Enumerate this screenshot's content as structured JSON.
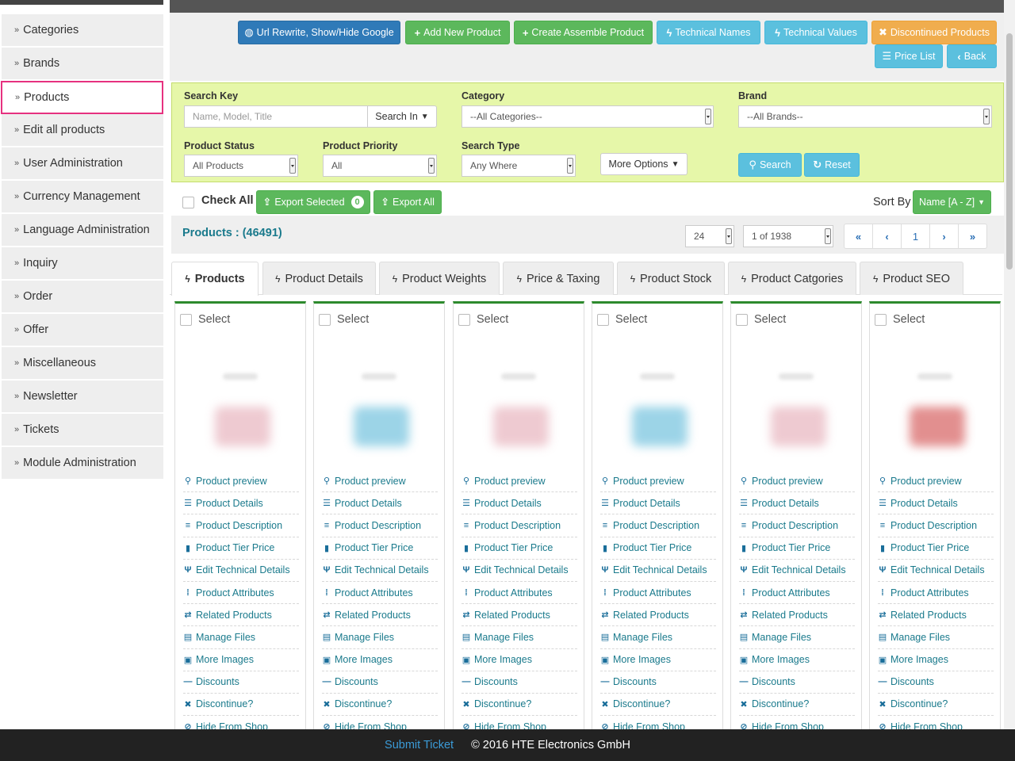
{
  "sidebar": {
    "items": [
      {
        "label": "Categories"
      },
      {
        "label": "Brands"
      },
      {
        "label": "Products"
      },
      {
        "label": "Edit all products"
      },
      {
        "label": "User Administration"
      },
      {
        "label": "Currency Management"
      },
      {
        "label": "Language Administration"
      },
      {
        "label": "Inquiry"
      },
      {
        "label": "Order"
      },
      {
        "label": "Offer"
      },
      {
        "label": "Miscellaneous"
      },
      {
        "label": "Newsletter"
      },
      {
        "label": "Tickets"
      },
      {
        "label": "Module Administration"
      }
    ],
    "active_item": "Products",
    "bullet": "»"
  },
  "toolbar": {
    "url_rewrite": "Url Rewrite, Show/Hide Google",
    "add_new_product": "Add New Product",
    "create_assemble_product": "Create Assemble Product",
    "technical_names": "Technical Names",
    "technical_values": "Technical Values",
    "discontinued_products": "Discontinued Products",
    "price_list": "Price List",
    "back": "Back"
  },
  "search": {
    "search_key_label": "Search Key",
    "search_key_placeholder": "Name, Model, Title",
    "search_in": "Search In",
    "category_label": "Category",
    "category_value": "--All Categories--",
    "brand_label": "Brand",
    "brand_value": "--All Brands--",
    "status_label": "Product Status",
    "status_value": "All Products",
    "priority_label": "Product Priority",
    "priority_value": "All",
    "type_label": "Search Type",
    "type_value": "Any Where",
    "more_options": "More Options",
    "search_button": "Search",
    "reset_button": "Reset"
  },
  "bulk": {
    "check_all": "Check All",
    "export_selected": "Export Selected",
    "selected_count": "0",
    "export_all": "Export All",
    "sort_by": "Sort By",
    "sort_value": "Name [A - Z]"
  },
  "results": {
    "count_label": "Products : (46491)",
    "per_page": "24",
    "page_of": "1 of 1938",
    "current_page": "1"
  },
  "tabs": [
    {
      "label": "Products"
    },
    {
      "label": "Product Details"
    },
    {
      "label": "Product Weights"
    },
    {
      "label": "Price & Taxing"
    },
    {
      "label": "Product Stock"
    },
    {
      "label": "Product Catgories"
    },
    {
      "label": "Product SEO"
    }
  ],
  "card": {
    "select": "Select",
    "actions": [
      {
        "label": "Product preview",
        "icon": "search-icon"
      },
      {
        "label": "Product Details",
        "icon": "list-icon"
      },
      {
        "label": "Product Description",
        "icon": "align-left-icon"
      },
      {
        "label": "Product Tier Price",
        "icon": "bar-chart-icon"
      },
      {
        "label": "Edit Technical Details",
        "icon": "cutlery-icon"
      },
      {
        "label": "Product Attributes",
        "icon": "grid-icon"
      },
      {
        "label": "Related Products",
        "icon": "retweet-icon"
      },
      {
        "label": "Manage Files",
        "icon": "file-icon"
      },
      {
        "label": "More Images",
        "icon": "picture-icon"
      },
      {
        "label": "Discounts",
        "icon": "minus-icon"
      },
      {
        "label": "Discontinue?",
        "icon": "remove-icon"
      },
      {
        "label": "Hide From Shop",
        "icon": "eye-slash-icon"
      }
    ],
    "thumb_colors": [
      "#e9b9c2",
      "#7cc6e0",
      "#e9b9c2",
      "#7cc6e0",
      "#e9b9c2",
      "#d96a6a"
    ]
  },
  "footer": {
    "submit_ticket": "Submit Ticket",
    "copyright": "© 2016 HTE Electronics GmbH"
  },
  "colors": {
    "accent_blue": "#2f7ab8",
    "green": "#5cb85c",
    "cyan": "#5bc0de",
    "orange": "#f0ad4e",
    "search_panel": "#e6f7a9",
    "active_border": "#e6317f",
    "link": "#1a7a8c"
  }
}
